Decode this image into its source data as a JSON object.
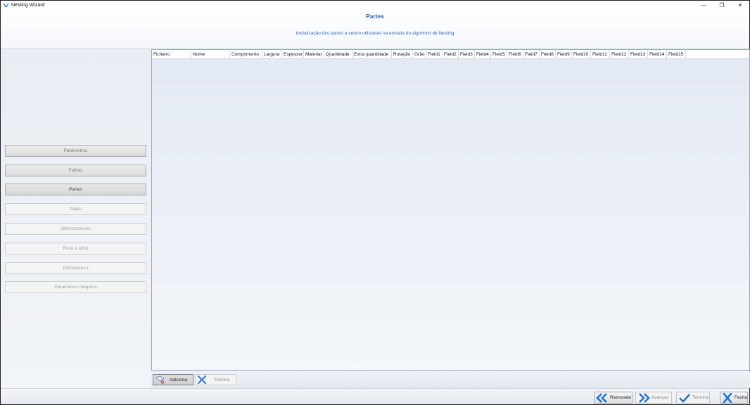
{
  "window": {
    "title": "Nesting Wizard",
    "controls": {
      "minimize": "—",
      "restore": "❐",
      "close": "✕"
    }
  },
  "header": {
    "title": "Partes",
    "subtitle": "Inicialização das partes a serem utilizadas na entrada do algoritmo de Nesting"
  },
  "nav": {
    "items": [
      {
        "label": "Parâmetros",
        "state": "normal"
      },
      {
        "label": "Folhas",
        "state": "normal"
      },
      {
        "label": "Partes",
        "state": "active"
      },
      {
        "label": "Taglio",
        "state": "disabled"
      },
      {
        "label": "Ottimizzazione",
        "state": "disabled"
      },
      {
        "label": "Resti e sfridi",
        "state": "disabled"
      },
      {
        "label": "Etichettatura",
        "state": "disabled"
      },
      {
        "label": "Parâmetros máquina",
        "state": "disabled"
      }
    ]
  },
  "grid": {
    "columns": [
      "Ficheiro",
      "Nome",
      "Comprimento",
      "Largura",
      "Espessor",
      "Material",
      "Quantidade",
      "Extra quantidade",
      "Rotação",
      "Grão",
      "Field1",
      "Field2",
      "Field3",
      "Field4",
      "Field5",
      "Field6",
      "Field7",
      "Field8",
      "Field9",
      "Field10",
      "Field11",
      "Field12",
      "Field13",
      "Field14",
      "Field15"
    ],
    "rows": []
  },
  "grid_toolbar": {
    "add_label": "Adiciona",
    "remove_label": "Elimina",
    "add_icon": "add-part-icon",
    "remove_icon": "delete-x-icon"
  },
  "footer": {
    "back_label": "Retrocede",
    "next_label": "Avançar",
    "finish_label": "Termina",
    "close_label": "Fecha",
    "accent_color": "#1f74d6"
  }
}
